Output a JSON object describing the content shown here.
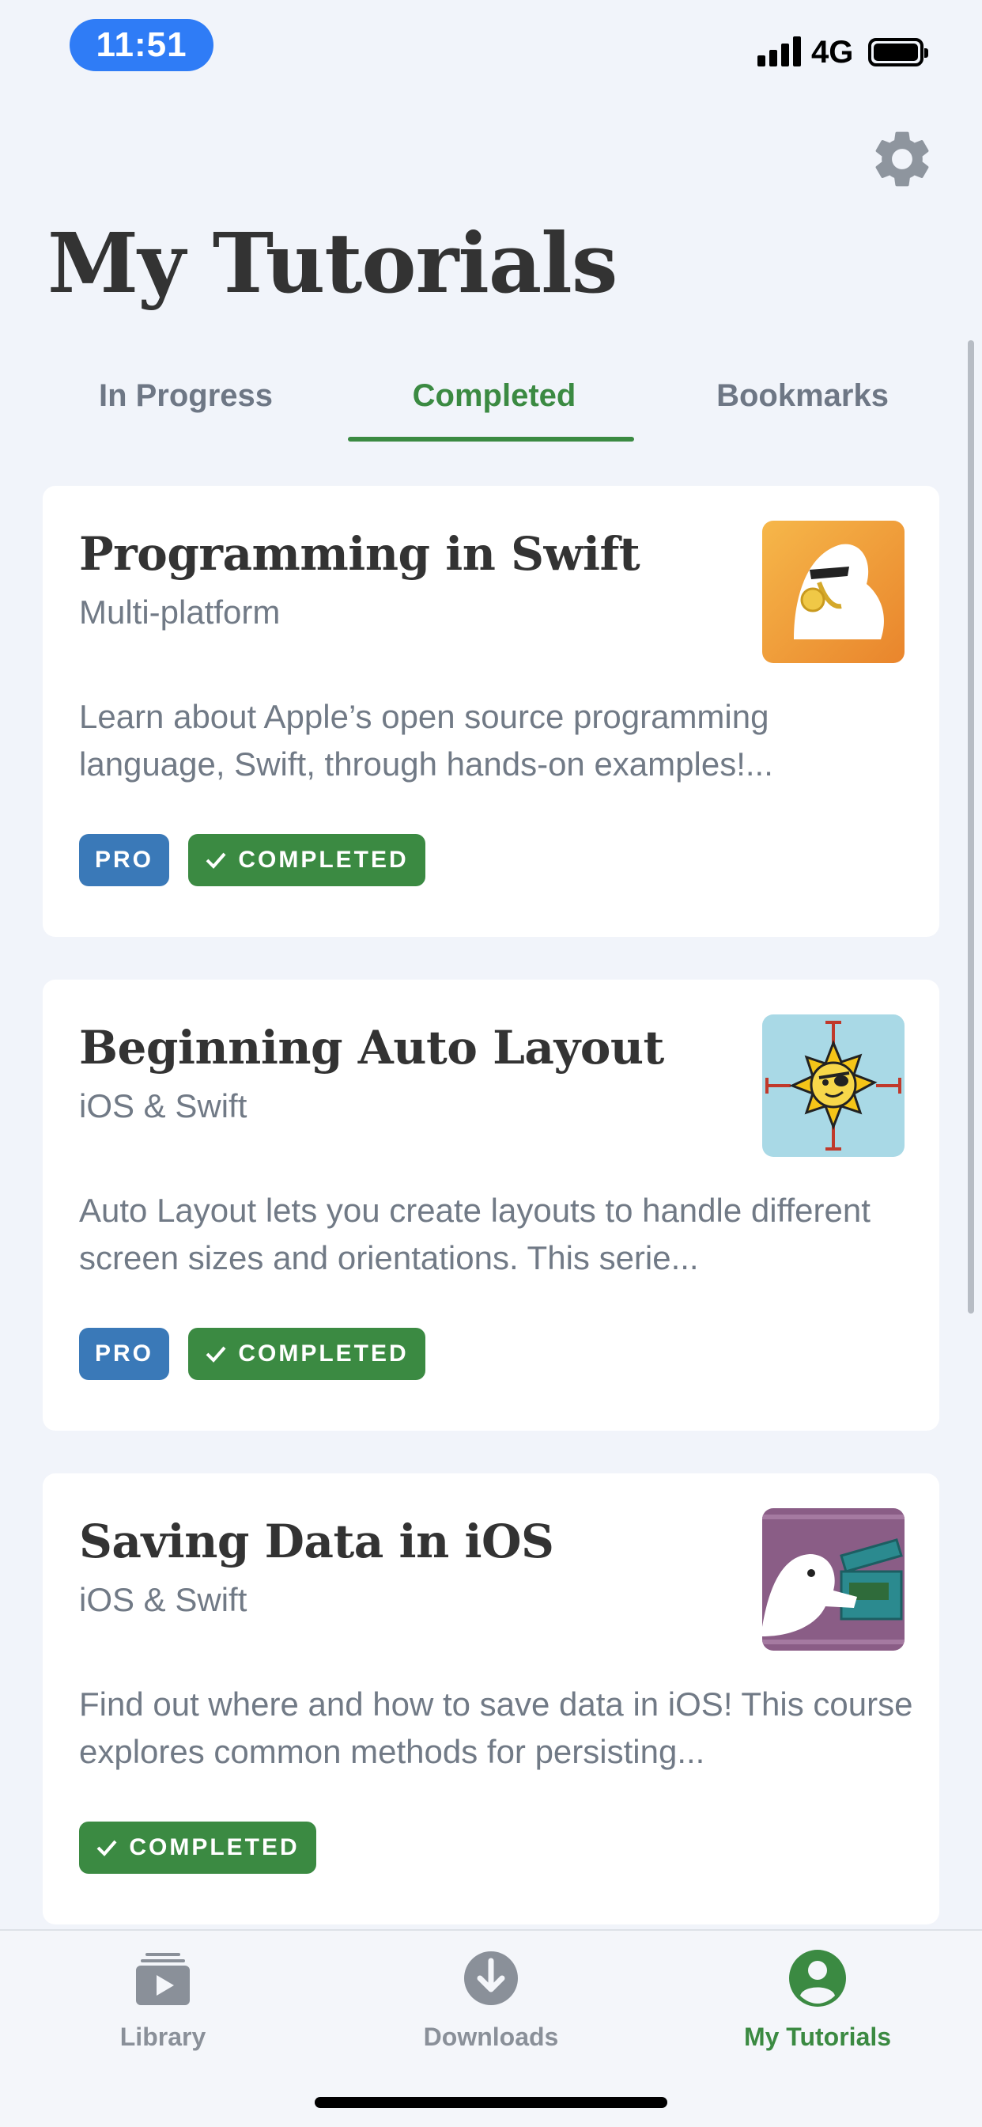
{
  "status_bar": {
    "time": "11:51",
    "network": "4G"
  },
  "header": {
    "title": "My Tutorials"
  },
  "tabs": [
    {
      "label": "In Progress",
      "active": false
    },
    {
      "label": "Completed",
      "active": true
    },
    {
      "label": "Bookmarks",
      "active": false
    }
  ],
  "cards": [
    {
      "title": "Programming in Swift",
      "subtitle": "Multi-platform",
      "description": "Learn about Apple’s open source programming language, Swift, through hands-on examples!...",
      "badges": [
        "PRO",
        "COMPLETED"
      ],
      "thumb_colors": [
        "#f2a33a",
        "#e98a30"
      ]
    },
    {
      "title": "Beginning Auto Layout",
      "subtitle": "iOS & Swift",
      "description": "Auto Layout lets you create layouts to handle different screen sizes and orientations. This serie...",
      "badges": [
        "PRO",
        "COMPLETED"
      ],
      "thumb_colors": [
        "#a9d9e6",
        "#8fcbdc"
      ]
    },
    {
      "title": "Saving Data in iOS",
      "subtitle": "iOS & Swift",
      "description": "Find out where and how to save data in iOS! This course explores common methods for persisting...",
      "badges": [
        "COMPLETED"
      ],
      "thumb_colors": [
        "#8a5d86",
        "#6e4a6c"
      ]
    }
  ],
  "tab_bar": [
    {
      "label": "Library",
      "icon": "library-icon",
      "active": false
    },
    {
      "label": "Downloads",
      "icon": "download-icon",
      "active": false
    },
    {
      "label": "My Tutorials",
      "icon": "profile-icon",
      "active": true
    }
  ],
  "colors": {
    "accent_green": "#3b8a42",
    "pro_blue": "#3a79b8",
    "status_pill_blue": "#2f7cf6"
  }
}
